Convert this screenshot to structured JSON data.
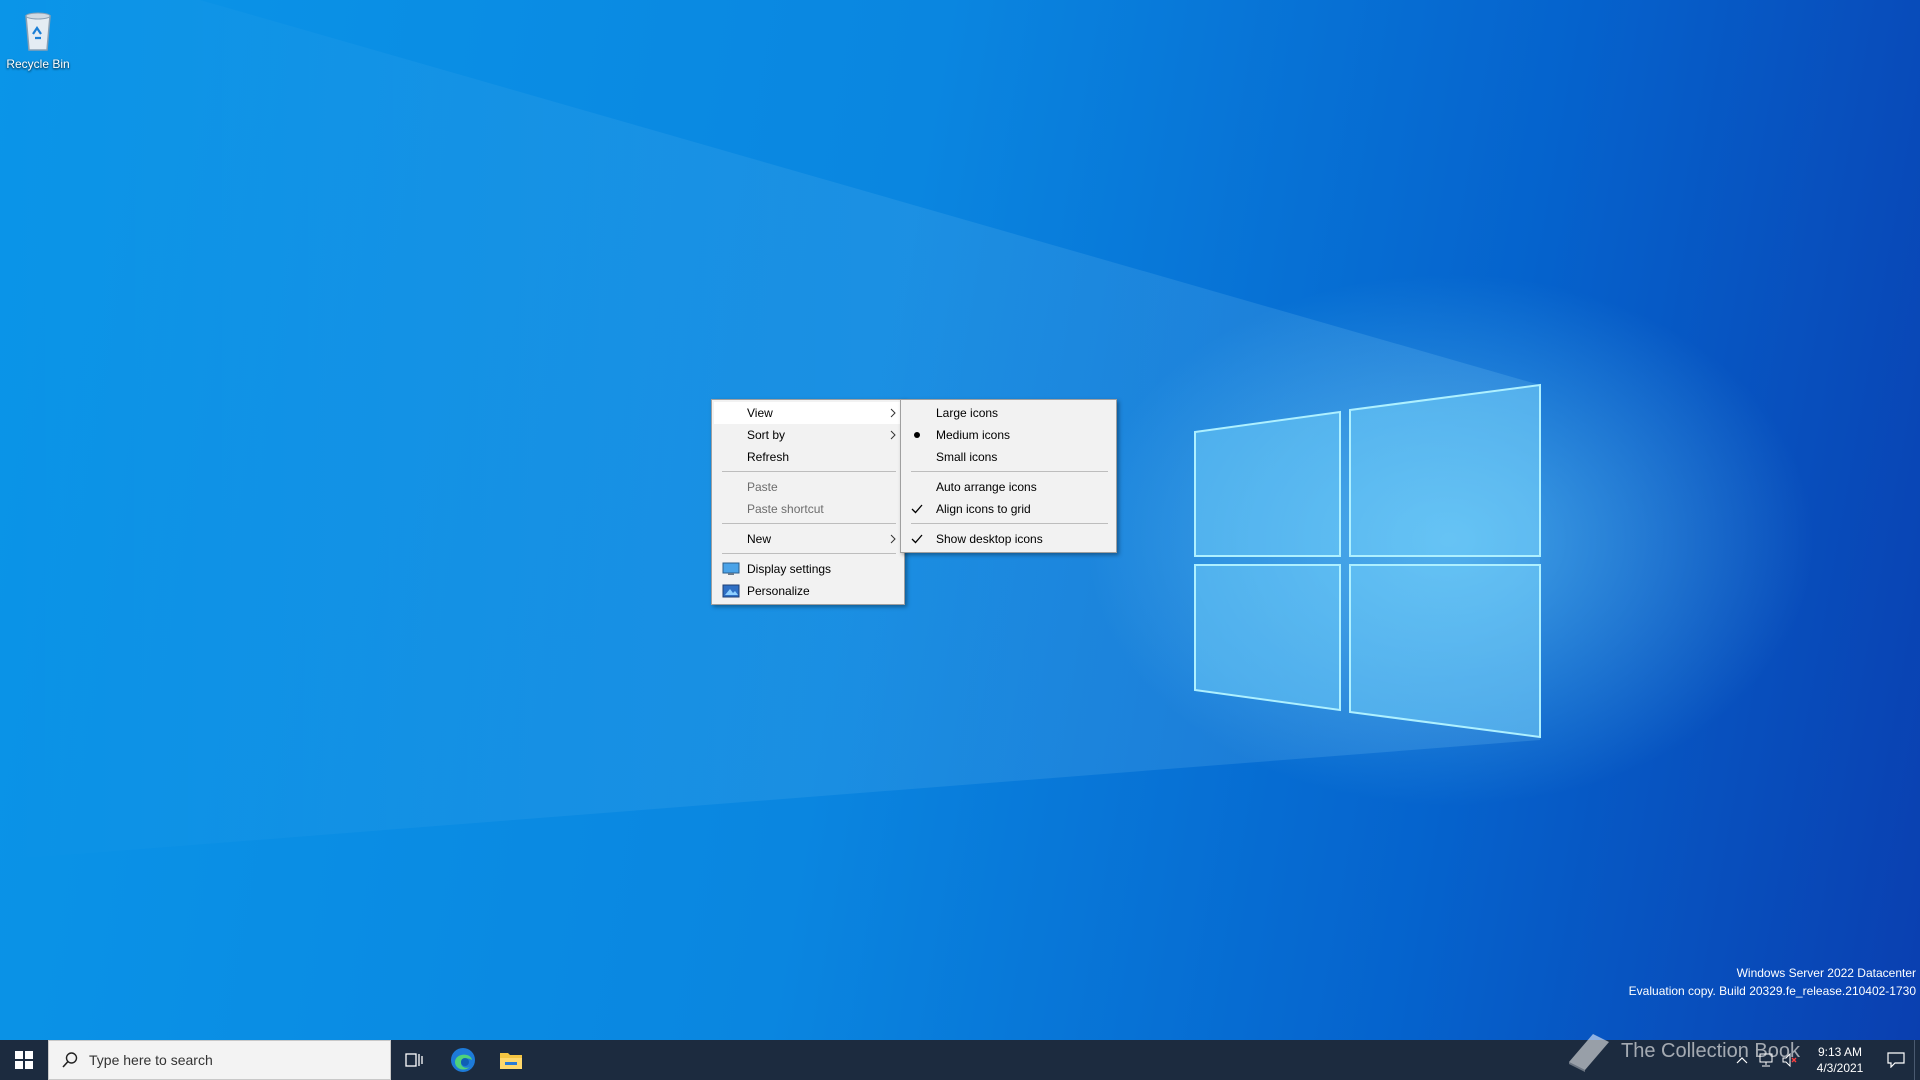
{
  "desktop": {
    "recycle_bin": {
      "label": "Recycle Bin",
      "icon": "recycle-bin-icon"
    }
  },
  "context_menu": {
    "items": [
      {
        "label": "View",
        "submenu": true,
        "disabled": false,
        "hover": true
      },
      {
        "label": "Sort by",
        "submenu": true,
        "disabled": false
      },
      {
        "label": "Refresh",
        "submenu": false,
        "disabled": false
      },
      {
        "label": "Paste",
        "submenu": false,
        "disabled": true
      },
      {
        "label": "Paste shortcut",
        "submenu": false,
        "disabled": true
      },
      {
        "label": "New",
        "submenu": true,
        "disabled": false
      },
      {
        "label": "Display settings",
        "icon": "display-icon",
        "disabled": false
      },
      {
        "label": "Personalize",
        "icon": "personalize-icon",
        "disabled": false
      }
    ]
  },
  "view_submenu": {
    "items": [
      {
        "label": "Large icons",
        "mark": "none"
      },
      {
        "label": "Medium icons",
        "mark": "radio"
      },
      {
        "label": "Small icons",
        "mark": "none"
      },
      {
        "label": "Auto arrange icons",
        "mark": "none"
      },
      {
        "label": "Align icons to grid",
        "mark": "check"
      },
      {
        "label": "Show desktop icons",
        "mark": "check"
      }
    ]
  },
  "watermark": {
    "line1": "Windows Server 2022 Datacenter",
    "line2": "Evaluation copy. Build 20329.fe_release.210402-1730"
  },
  "taskbar": {
    "search_placeholder": "Type here to search",
    "pinned": [
      "task-view-icon",
      "edge-icon",
      "file-explorer-icon"
    ],
    "clock_time": "9:13 AM",
    "clock_date": "4/3/2021",
    "overlay_text": "The Collection Book"
  },
  "colors": {
    "taskbar": "#1c2b3f",
    "menu_bg": "#f2f2f2",
    "desktop_blue": "#0a86e0"
  }
}
